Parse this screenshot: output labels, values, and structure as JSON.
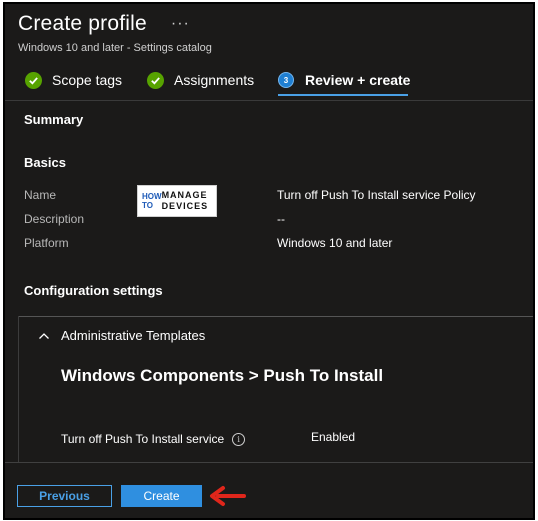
{
  "header": {
    "title": "Create profile",
    "more_label": "···",
    "subtitle": "Windows 10 and later - Settings catalog"
  },
  "steps": [
    {
      "label": "Scope tags",
      "state": "complete"
    },
    {
      "label": "Assignments",
      "state": "complete"
    },
    {
      "label": "Review + create",
      "state": "active",
      "number": "3"
    }
  ],
  "summary": {
    "heading": "Summary",
    "basics_heading": "Basics",
    "fields": [
      {
        "label": "Name",
        "value": "Turn off Push To Install service Policy"
      },
      {
        "label": "Description",
        "value": "--"
      },
      {
        "label": "Platform",
        "value": "Windows 10 and later"
      }
    ],
    "watermark": {
      "line1": "HOW TO",
      "line2": "MANAGE DEVICES"
    }
  },
  "configuration": {
    "heading": "Configuration settings",
    "group": "Administrative Templates",
    "category": "Windows Components > Push To Install",
    "setting": {
      "label": "Turn off Push To Install service",
      "value": "Enabled"
    }
  },
  "footer": {
    "previous_label": "Previous",
    "create_label": "Create"
  },
  "colors": {
    "background": "#1b1a19",
    "accent": "#4aa0e6",
    "success": "#57a300",
    "annotation_arrow": "#e0261b"
  },
  "icons": [
    "checkmark-icon",
    "step-number-icon",
    "chevron-up-icon",
    "info-icon",
    "red-arrow-icon"
  ]
}
